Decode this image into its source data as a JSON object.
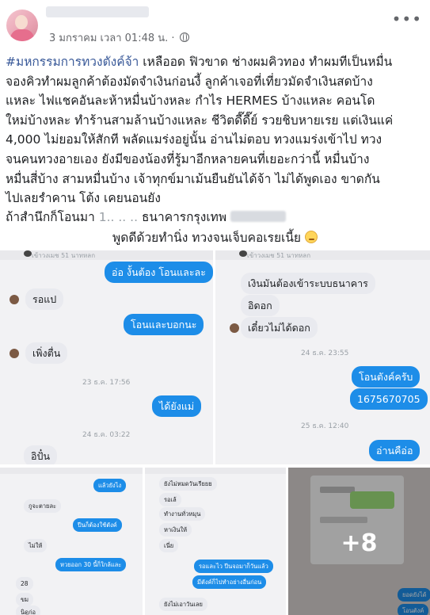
{
  "post": {
    "timestamp": "3 มกราคม เวลา 01:48 น. ·",
    "icons": {
      "privacy": "globe-icon",
      "menu": "more-icon"
    },
    "hashtag": "#มหกรรมการทวงตังค์จ้า",
    "lines": [
      " เหลืออด ฟิวขาด ช่างผมคิวทอง ทำผมทีเป็นหมื่น",
      "จองคิวทำผมลูกค้าต้องมัดจำเงินก่อนงี้ ลูกค้าเจอที่เที่ยวมัดจำเงินสดบ้าง",
      "แหละ ไฟแชคอันละห้าหมื่นบ้างหละ กำไร HERMES บ้างแหละ คอนโด",
      "ใหม่บ้างหละ ทำร้านสามล้านบ้างแหละ ชีวิตดี๊ดี๊ย์ รวยชิบหายเรย แต่เงินแค่",
      "4,000 ไม่ยอมให้สักที พลัดแมร่งอยู่นั้น อ่านไม่ตอบ ทวงแมร่งเข้าไป ทวง",
      "จนคนทวงอายเอง ยังมีของน้องที่รู้มาอีกหลายคนที่เยอะกว่านี้ หมื่นบ้าง",
      "หมื่นสี่บ้าง สามหมื่นบ้าง เจ้าทุกข์มาเม้นยืนยันได้จ้า ไม่ได้พูดเอง ขาดกัน",
      "ไปเลยรำคาน โต้ง เคยนอนยัง"
    ],
    "account_prefix": "ถ้าสำนึกก็โอนมา",
    "account_number_partial": "1..  ..  ..",
    "bank": "ธนาคารกรุงเทพ",
    "closing": "พูดดีด้วยทำนิ่ง ทวงจนเจ็บคอเรยเนี้ย"
  },
  "chat1": {
    "header": "เข้าวงเมช 51 นาทหลก",
    "messages": [
      {
        "side": "out",
        "text": "อ่อ งั้นต้อง โอนและละ"
      },
      {
        "side": "in",
        "text": "รอแป"
      },
      {
        "side": "out",
        "text": "โอนและบอกนะ"
      },
      {
        "side": "in",
        "text": "เพิ่งตื่น"
      },
      {
        "side": "time",
        "text": "23 ธ.ค. 17:56"
      },
      {
        "side": "out",
        "text": "ได้ยังแม่"
      },
      {
        "side": "time",
        "text": "24 ธ.ค. 03:22"
      },
      {
        "side": "in",
        "text": "อิปั๋น"
      }
    ]
  },
  "chat2": {
    "header": "เข้าวงเมช 51 นาทหลก",
    "messages": [
      {
        "side": "in",
        "text": "เงินมันต้องเข้าระบบธนาคาร"
      },
      {
        "side": "in",
        "text": "อิดอก"
      },
      {
        "side": "in",
        "text": "เดี๋ยวไม่ได้ดอก"
      },
      {
        "side": "time",
        "text": "24 ธ.ค. 23:55"
      },
      {
        "side": "out",
        "text": "โอนตังค์ครับ"
      },
      {
        "side": "out",
        "text": "1675670705"
      },
      {
        "side": "time",
        "text": "25 ธ.ค. 12:40"
      },
      {
        "side": "out",
        "text": "อ่านคือ่อ"
      }
    ]
  },
  "chat3": {
    "messages": [
      {
        "side": "out",
        "text": "แล้วยังไง"
      },
      {
        "side": "in",
        "text": "กูจะตายละ"
      },
      {
        "side": "out",
        "text": "ปีนก็ต้องใช้ตังค์"
      },
      {
        "side": "in",
        "text": "ไม่ให้"
      },
      {
        "side": "out",
        "text": "หวยออก 30 นี้ก็ใกล้และ"
      },
      {
        "side": "in",
        "text": "28"
      },
      {
        "side": "in",
        "text": "ขม"
      },
      {
        "side": "in",
        "text": "นิดูก่อ"
      }
    ]
  },
  "chat4": {
    "messages": [
      {
        "side": "in",
        "text": "ยังไม่หมดวันเรียยย"
      },
      {
        "side": "in",
        "text": "รอเล้"
      },
      {
        "side": "in",
        "text": "ทำงานทั่วหมุน"
      },
      {
        "side": "in",
        "text": "หาเงินให้"
      },
      {
        "side": "in",
        "text": "เนี่ย"
      },
      {
        "side": "out",
        "text": "รอและไว ปีนจอมาก็วันแล้ว"
      },
      {
        "side": "out",
        "text": "มีตังค์ก็ไปทำอย่างอื่นก่อน"
      },
      {
        "side": "in",
        "text": "ยังไม่เอาวันเลย"
      }
    ]
  },
  "chat5": {
    "more_label": "+8",
    "messages": [
      {
        "side": "out",
        "text": "ยอดยังได้"
      },
      {
        "side": "out",
        "text": "โอนตังค์"
      }
    ]
  }
}
